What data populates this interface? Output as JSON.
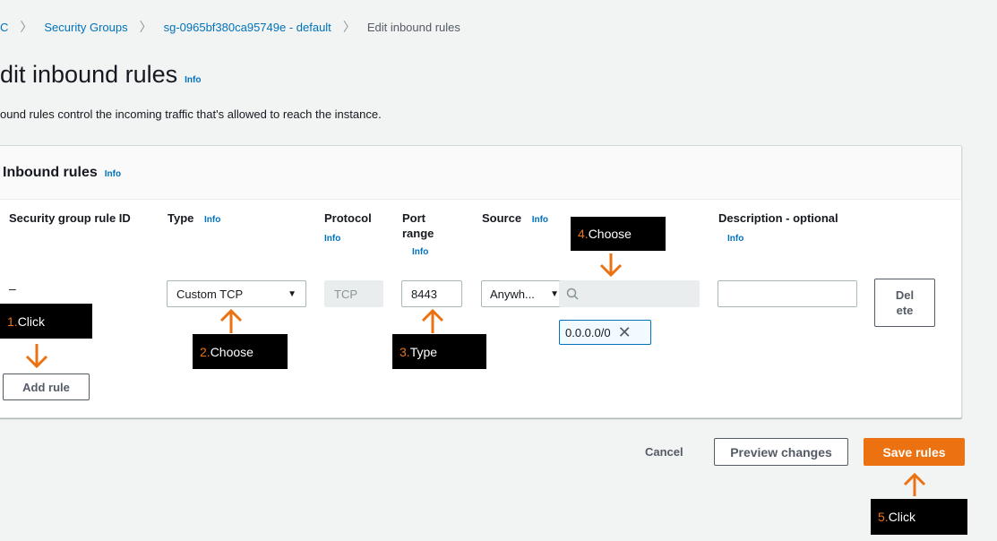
{
  "breadcrumb": {
    "items": [
      "C",
      "Security Groups",
      "sg-0965bf380ca95749e - default"
    ],
    "current": "Edit inbound rules"
  },
  "page": {
    "title": "dit inbound rules",
    "info": "Info",
    "description": "ound rules control the incoming traffic that's allowed to reach the instance."
  },
  "panel": {
    "title": "Inbound rules",
    "info": "Info",
    "columns": {
      "rule_id": "Security group rule ID",
      "type": "Type",
      "type_info": "Info",
      "protocol": "Protocol",
      "protocol_info": "Info",
      "port_range_line1": "Port",
      "port_range_line2": "range",
      "port_info": "Info",
      "source": "Source",
      "source_info": "Info",
      "description": "Description - optional",
      "description_info": "Info"
    },
    "row": {
      "rule_id": "–",
      "type": "Custom TCP",
      "protocol": "TCP",
      "port_range": "8443",
      "source": "Anywh...",
      "source_search_value": "",
      "cidr_token": "0.0.0.0/0",
      "description_value": "",
      "delete_line1": "Del",
      "delete_line2": "ete"
    },
    "add_rule": "Add rule"
  },
  "footer": {
    "cancel": "Cancel",
    "preview": "Preview changes",
    "save": "Save rules"
  },
  "annotations": {
    "a1": {
      "step": "1.",
      "text": " Click"
    },
    "a2": {
      "step": "2.",
      "text": " Choose"
    },
    "a3": {
      "step": "3.",
      "text": " Type"
    },
    "a4": {
      "step": "4.",
      "text": " Choose"
    },
    "a5": {
      "step": "5.",
      "text": " Click"
    }
  },
  "colors": {
    "link": "#0073bb",
    "accent": "#ec7211",
    "background": "#f2f3f3"
  },
  "icons": {
    "dropdown": "caret-down-icon",
    "search": "search-icon",
    "remove_token": "close-icon",
    "breadcrumb_separator": "chevron-right-icon",
    "annotation_arrow": "arrow-icon"
  }
}
